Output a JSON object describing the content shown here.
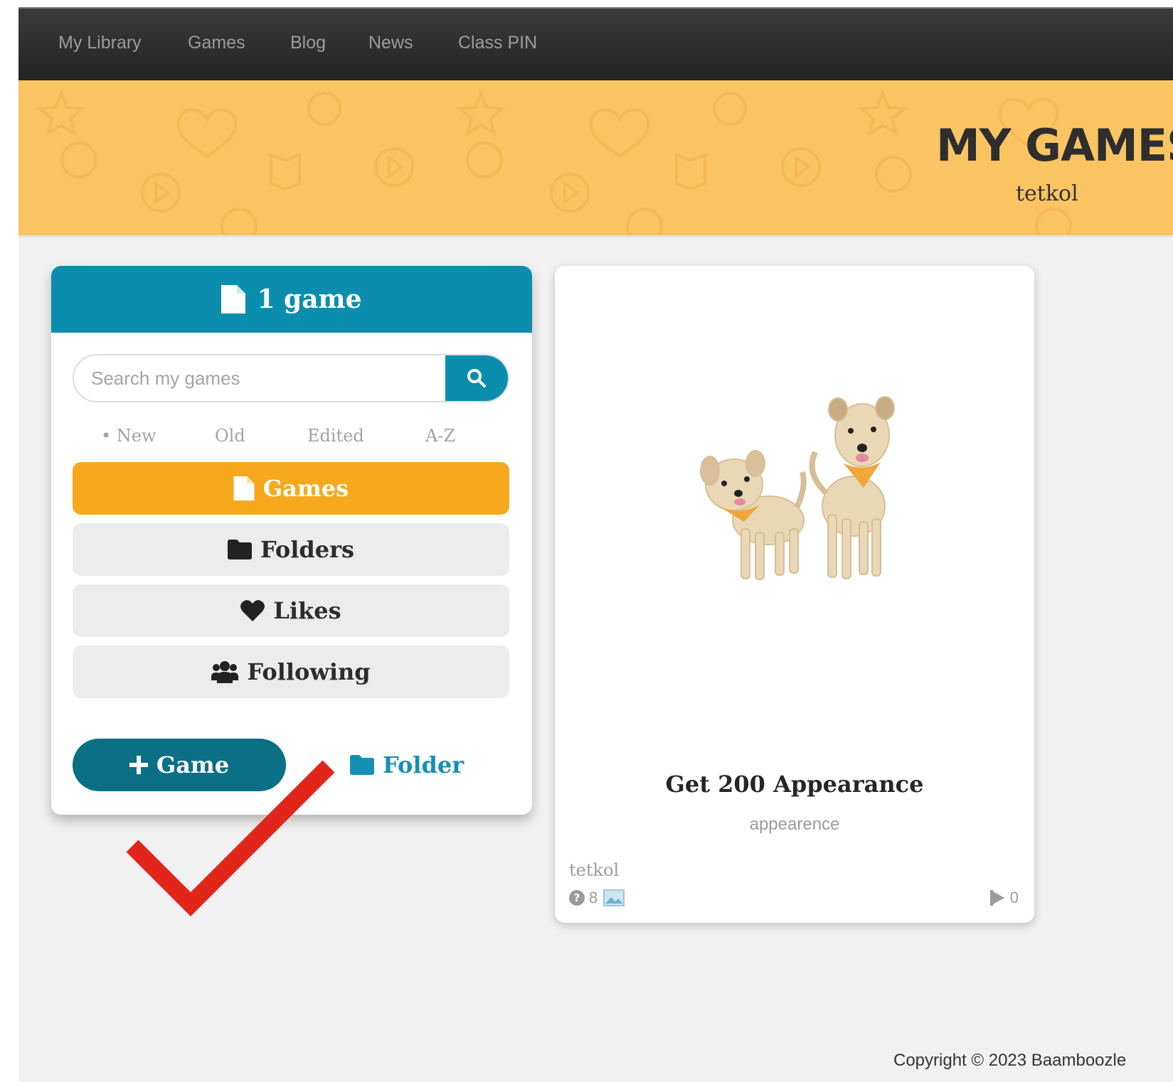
{
  "nav": {
    "items": [
      "My Library",
      "Games",
      "Blog",
      "News",
      "Class PIN"
    ]
  },
  "banner": {
    "title": "MY GAMES",
    "username": "tetkol"
  },
  "panel": {
    "count_label": "1 game",
    "search": {
      "placeholder": "Search my games",
      "value": ""
    },
    "sort": {
      "new": "• New",
      "old": "Old",
      "edited": "Edited",
      "az": "A-Z"
    },
    "tabs": {
      "games": "Games",
      "folders": "Folders",
      "likes": "Likes",
      "following": "Following"
    },
    "add_game": "Game",
    "add_folder": "Folder"
  },
  "card": {
    "title": "Get 200 Appearance",
    "description": "appearence",
    "author": "tetkol",
    "questions": "8",
    "plays": "0"
  },
  "footer": {
    "copyright": "Copyright © 2023 Baamboozle"
  },
  "colors": {
    "nav_bg": "#2b2b2b",
    "banner": "#fac462",
    "teal": "#0b8ead",
    "dark_teal": "#0b6f86",
    "orange": "#f6a91d",
    "check_red": "#e1251b"
  },
  "icons": [
    "file-icon",
    "search-icon",
    "folder-icon",
    "heart-icon",
    "users-icon",
    "plus-icon",
    "question-icon",
    "image-icon",
    "play-icon",
    "checkmark-icon"
  ]
}
